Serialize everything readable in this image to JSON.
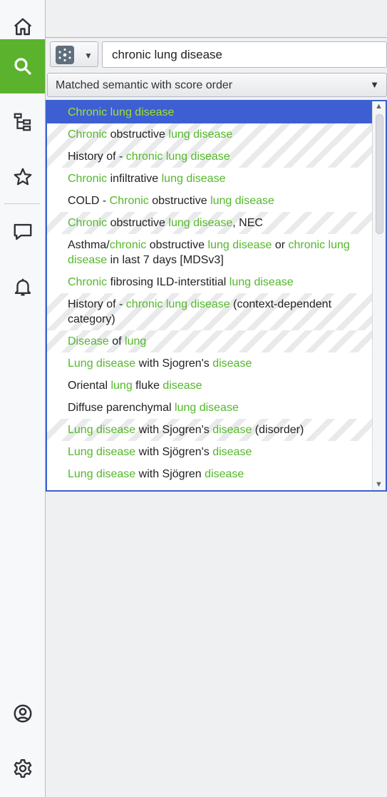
{
  "sidebar": {
    "items": [
      {
        "name": "home-icon",
        "active": false
      },
      {
        "name": "search-icon",
        "active": true
      },
      {
        "name": "hierarchy-icon",
        "active": false
      },
      {
        "name": "star-icon",
        "active": false
      },
      {
        "name": "chat-icon",
        "active": false
      },
      {
        "name": "bell-icon",
        "active": false
      },
      {
        "name": "user-icon",
        "active": false
      },
      {
        "name": "gear-icon",
        "active": false
      }
    ]
  },
  "search": {
    "value": "chronic lung disease"
  },
  "sort": {
    "selected": "Matched semantic with score order"
  },
  "results": [
    {
      "selected": true,
      "striped": false,
      "segments": [
        [
          "Chronic",
          true
        ],
        [
          " ",
          false
        ],
        [
          "lung",
          true
        ],
        [
          " ",
          false
        ],
        [
          "disease",
          true
        ]
      ]
    },
    {
      "selected": false,
      "striped": true,
      "segments": [
        [
          "Chronic",
          true
        ],
        [
          " obstructive ",
          false
        ],
        [
          "lung",
          true
        ],
        [
          " ",
          false
        ],
        [
          "disease",
          true
        ]
      ]
    },
    {
      "selected": false,
      "striped": true,
      "segments": [
        [
          "History of - ",
          false
        ],
        [
          "chronic",
          true
        ],
        [
          " ",
          false
        ],
        [
          "lung",
          true
        ],
        [
          " ",
          false
        ],
        [
          "disease",
          true
        ]
      ]
    },
    {
      "selected": false,
      "striped": false,
      "segments": [
        [
          "Chronic",
          true
        ],
        [
          " infiltrative ",
          false
        ],
        [
          "lung",
          true
        ],
        [
          " ",
          false
        ],
        [
          "disease",
          true
        ]
      ]
    },
    {
      "selected": false,
      "striped": false,
      "segments": [
        [
          "COLD - ",
          false
        ],
        [
          "Chronic",
          true
        ],
        [
          " obstructive ",
          false
        ],
        [
          "lung",
          true
        ],
        [
          " ",
          false
        ],
        [
          "disease",
          true
        ]
      ]
    },
    {
      "selected": false,
      "striped": true,
      "segments": [
        [
          "Chronic",
          true
        ],
        [
          " obstructive ",
          false
        ],
        [
          "lung",
          true
        ],
        [
          " ",
          false
        ],
        [
          "disease",
          true
        ],
        [
          ", NEC",
          false
        ]
      ]
    },
    {
      "selected": false,
      "striped": false,
      "segments": [
        [
          "Asthma/",
          false
        ],
        [
          "chronic",
          true
        ],
        [
          " obstructive ",
          false
        ],
        [
          "lung",
          true
        ],
        [
          " ",
          false
        ],
        [
          "disease",
          true
        ],
        [
          " or ",
          false
        ],
        [
          "chronic",
          true
        ],
        [
          " ",
          false
        ],
        [
          "lung",
          true
        ],
        [
          " ",
          false
        ],
        [
          "disease",
          true
        ],
        [
          " in last 7 days [MDSv3]",
          false
        ]
      ]
    },
    {
      "selected": false,
      "striped": false,
      "segments": [
        [
          "Chronic",
          true
        ],
        [
          " fibrosing ILD-interstitial ",
          false
        ],
        [
          "lung",
          true
        ],
        [
          " ",
          false
        ],
        [
          "disease",
          true
        ]
      ]
    },
    {
      "selected": false,
      "striped": true,
      "segments": [
        [
          "History of - ",
          false
        ],
        [
          "chronic",
          true
        ],
        [
          " ",
          false
        ],
        [
          "lung",
          true
        ],
        [
          " ",
          false
        ],
        [
          "disease",
          true
        ],
        [
          " (context-dependent category)",
          false
        ]
      ]
    },
    {
      "selected": false,
      "striped": true,
      "segments": [
        [
          "Disease",
          true
        ],
        [
          " of ",
          false
        ],
        [
          "lung",
          true
        ]
      ]
    },
    {
      "selected": false,
      "striped": false,
      "segments": [
        [
          "Lung",
          true
        ],
        [
          " ",
          false
        ],
        [
          "disease",
          true
        ],
        [
          " with Sjogren's ",
          false
        ],
        [
          "disease",
          true
        ]
      ]
    },
    {
      "selected": false,
      "striped": false,
      "segments": [
        [
          "Oriental ",
          false
        ],
        [
          "lung",
          true
        ],
        [
          " fluke ",
          false
        ],
        [
          "disease",
          true
        ]
      ]
    },
    {
      "selected": false,
      "striped": false,
      "segments": [
        [
          "Diffuse parenchymal ",
          false
        ],
        [
          "lung",
          true
        ],
        [
          " ",
          false
        ],
        [
          "disease",
          true
        ]
      ]
    },
    {
      "selected": false,
      "striped": true,
      "segments": [
        [
          "Lung",
          true
        ],
        [
          " ",
          false
        ],
        [
          "disease",
          true
        ],
        [
          " with Sjogren's ",
          false
        ],
        [
          "disease",
          true
        ],
        [
          " (disorder)",
          false
        ]
      ]
    },
    {
      "selected": false,
      "striped": false,
      "segments": [
        [
          "Lung",
          true
        ],
        [
          " ",
          false
        ],
        [
          "disease",
          true
        ],
        [
          " with Sjögren's ",
          false
        ],
        [
          "disease",
          true
        ]
      ]
    },
    {
      "selected": false,
      "striped": false,
      "segments": [
        [
          "Lung",
          true
        ],
        [
          " ",
          false
        ],
        [
          "disease",
          true
        ],
        [
          " with Sjögren ",
          false
        ],
        [
          "disease",
          true
        ]
      ]
    }
  ]
}
